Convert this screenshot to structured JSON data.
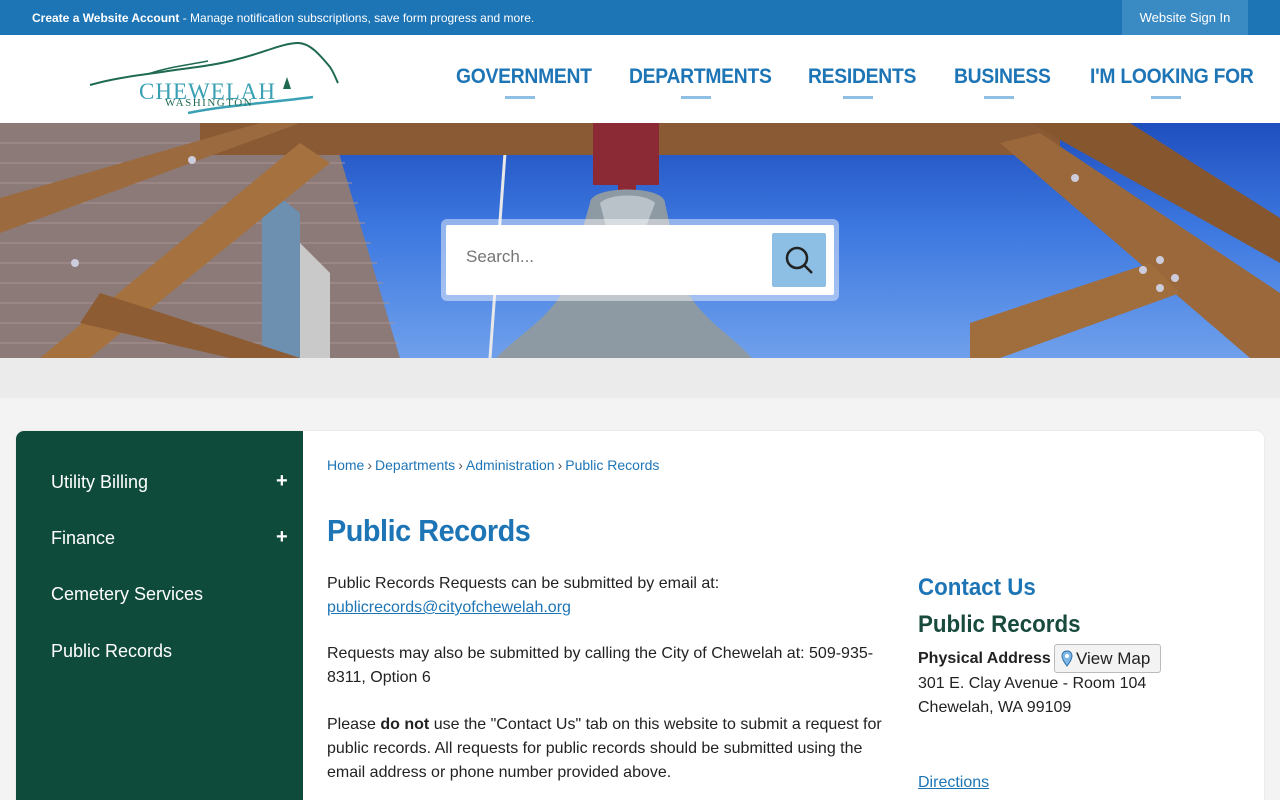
{
  "topbar": {
    "create_account": "Create a Website Account",
    "message": " - Manage notification subscriptions, save form progress and more.",
    "sign_in": "Website Sign In"
  },
  "logo": {
    "name": "CHEWELAH",
    "subtitle": "WASHINGTON"
  },
  "nav": [
    {
      "label": "GOVERNMENT"
    },
    {
      "label": "DEPARTMENTS"
    },
    {
      "label": "RESIDENTS"
    },
    {
      "label": "BUSINESS"
    },
    {
      "label": "I'M LOOKING FOR"
    }
  ],
  "search": {
    "placeholder": "Search...",
    "icon": "search-icon"
  },
  "sidebar": {
    "items": [
      {
        "label": "Utility Billing",
        "expand": "+"
      },
      {
        "label": "Finance",
        "expand": "+"
      },
      {
        "label": "Cemetery Services",
        "expand": ""
      },
      {
        "label": "Public Records",
        "expand": ""
      }
    ]
  },
  "breadcrumb": [
    "Home",
    "Departments",
    "Administration",
    "Public Records"
  ],
  "breadcrumb_sep": "›",
  "page_title": "Public Records",
  "content": {
    "p1_text": "Public Records Requests can be submitted by email at:",
    "p1_email": "publicrecords@cityofchewelah.org",
    "p2_text": "Requests may also be submitted by calling the City of Chewelah at: 509-935-8311, Option 6",
    "p3_before": "Please ",
    "p3_bold": "do not",
    "p3_after": " use the \"Contact Us\" tab on this website to submit a request for public records. All requests for public records should be submitted using the email address or phone number provided above."
  },
  "contact": {
    "heading": "Contact Us",
    "department": "Public Records",
    "address_label": "Physical Address",
    "view_map": "View Map",
    "address_line1": "301 E. Clay Avenue - Room 104",
    "address_line2": "Chewelah, WA 99109",
    "directions": "Directions"
  },
  "colors": {
    "brand_blue": "#1e75b6",
    "sidebar_green": "#0f4b3a"
  }
}
